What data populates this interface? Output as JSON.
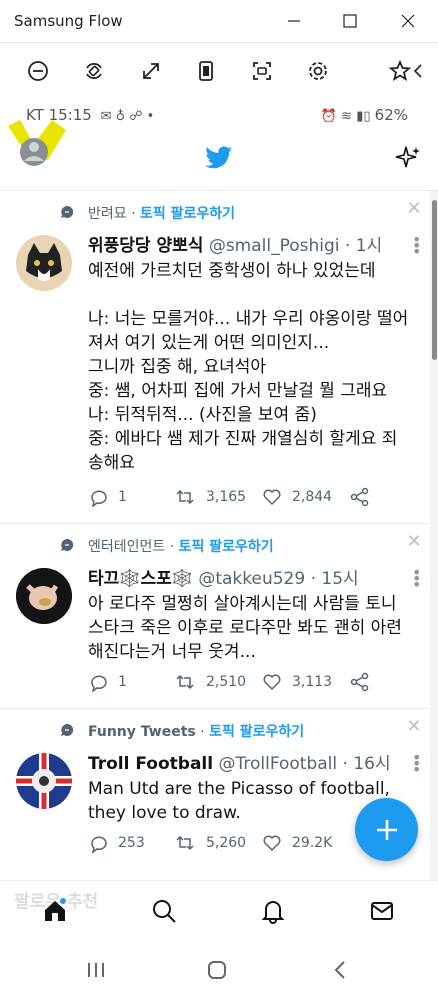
{
  "window": {
    "title": "Samsung Flow"
  },
  "status": {
    "left": "KT 15:15",
    "battery": "62%"
  },
  "topic_follow": "토픽 팔로우하기",
  "tweets": [
    {
      "topic": "반려묘",
      "name": "위풍당당 양뽀식",
      "handle": "@small_Poshigi",
      "time": "· 1시",
      "body": "예전에 가르치던 중학생이 하나 있었는데\n\n나: 너는 모를거야... 내가 우리 야옹이랑 떨어져서 여기 있는게 어떤 의미인지...\n그니까 집중 해, 요녀석아\n중: 쌤, 어차피 집에 가서 만날걸 뭘 그래요\n나: 뒤적뒤적... (사진을 보여 줌)\n중: 에바다 쌤 제가 진짜 개열심히 할게요 죄송해요",
      "replies": "1",
      "retweets": "3,165",
      "likes": "2,844"
    },
    {
      "topic": "엔터테인먼트",
      "name": "타끄🕸️스포🕸️",
      "handle": "@takkeu529",
      "time": "· 15시",
      "body": "아 로다주 멀쩡히 살아계시는데 사람들 토니 스타크 죽은 이후로 로다주만 봐도 괜히 아련해진다는거 너무 웃겨...",
      "replies": "1",
      "retweets": "2,510",
      "likes": "3,113"
    },
    {
      "topic": "Funny Tweets",
      "name": "Troll Football",
      "handle": "@TrollFootball",
      "time": "· 16시",
      "body": "Man Utd are the Picasso of football, they love to draw.",
      "replies": "253",
      "retweets": "5,260",
      "likes": "29.2K"
    }
  ],
  "ghost_text": "팔로우 추천",
  "colors": {
    "accent": "#1d9bf0",
    "avatar_highlight": "#e8e400"
  }
}
